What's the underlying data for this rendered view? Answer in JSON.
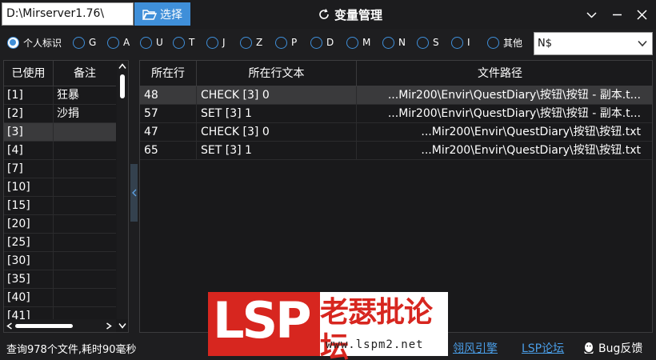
{
  "toolbar": {
    "path": "D:\\Mirserver1.76\\",
    "choose_label": "选择",
    "title": "变量管理"
  },
  "radios": [
    {
      "label": "个人标识",
      "checked": true
    },
    {
      "label": "G",
      "checked": false
    },
    {
      "label": "A",
      "checked": false
    },
    {
      "label": "U",
      "checked": false
    },
    {
      "label": "T",
      "checked": false
    },
    {
      "label": "J",
      "checked": false
    },
    {
      "label": "Z",
      "checked": false
    },
    {
      "label": "P",
      "checked": false
    },
    {
      "label": "D",
      "checked": false
    },
    {
      "label": "M",
      "checked": false
    },
    {
      "label": "N",
      "checked": false
    },
    {
      "label": "S",
      "checked": false
    },
    {
      "label": "I",
      "checked": false
    },
    {
      "label": "其他",
      "checked": false
    }
  ],
  "other_select": {
    "value": "N$"
  },
  "left_table": {
    "headers": [
      "已使用",
      "备注"
    ],
    "rows": [
      {
        "used": "[1]",
        "note": "狂暴"
      },
      {
        "used": "[2]",
        "note": "沙捐"
      },
      {
        "used": "[3]",
        "note": ""
      },
      {
        "used": "[4]",
        "note": ""
      },
      {
        "used": "[7]",
        "note": ""
      },
      {
        "used": "[10]",
        "note": ""
      },
      {
        "used": "[15]",
        "note": ""
      },
      {
        "used": "[20]",
        "note": ""
      },
      {
        "used": "[25]",
        "note": ""
      },
      {
        "used": "[30]",
        "note": ""
      },
      {
        "used": "[35]",
        "note": ""
      },
      {
        "used": "[40]",
        "note": ""
      },
      {
        "used": "[41]",
        "note": ""
      }
    ],
    "selected_index": 2
  },
  "right_table": {
    "headers": [
      "所在行",
      "所在行文本",
      "文件路径"
    ],
    "rows": [
      {
        "line": "48",
        "text": "CHECK [3] 0",
        "path": "...Mir200\\Envir\\QuestDiary\\按钮\\按钮 - 副本.t..."
      },
      {
        "line": "57",
        "text": "SET [3] 1",
        "path": "...Mir200\\Envir\\QuestDiary\\按钮\\按钮 - 副本.t..."
      },
      {
        "line": "47",
        "text": "CHECK [3] 0",
        "path": "...Mir200\\Envir\\QuestDiary\\按钮\\按钮.txt"
      },
      {
        "line": "65",
        "text": "SET [3] 1",
        "path": "...Mir200\\Envir\\QuestDiary\\按钮\\按钮.txt"
      }
    ],
    "selected_index": 0
  },
  "footer": {
    "status": "查询978个文件,耗时90毫秒",
    "link1": "翎风引擎",
    "link2": "LSP论坛",
    "bug": "Bug反馈"
  },
  "watermark": {
    "brand": "LSP",
    "cn": "老瑟批论坛",
    "url": "www.lspm2.net"
  },
  "colors": {
    "accent": "#3f8fd9",
    "background": "#1e1e20",
    "link": "#4a9ee8",
    "logo_red": "#d7261f"
  }
}
